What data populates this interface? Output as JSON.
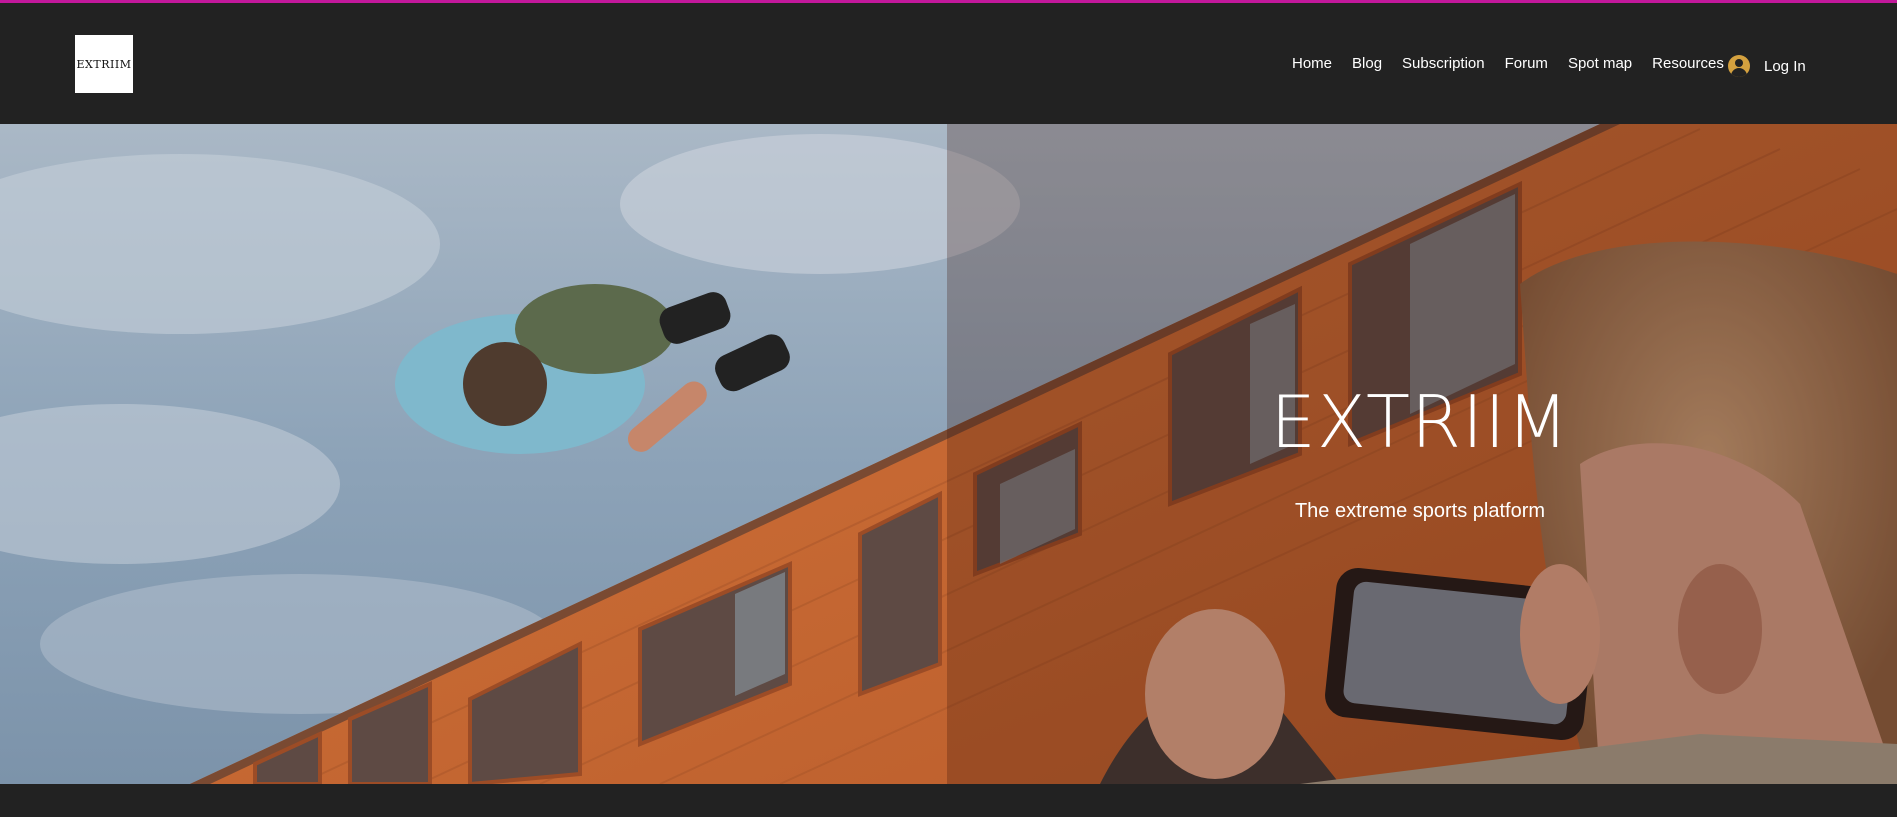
{
  "brand": {
    "logo_text": "EXTRIIM"
  },
  "nav": {
    "items": [
      {
        "label": "Home"
      },
      {
        "label": "Blog"
      },
      {
        "label": "Subscription"
      },
      {
        "label": "Forum"
      },
      {
        "label": "Spot map"
      },
      {
        "label": "Resources"
      }
    ],
    "login_label": "Log In"
  },
  "hero": {
    "title": "EXTRIIM",
    "subtitle": "The extreme sports platform"
  },
  "colors": {
    "accent": "#c2189b",
    "header_bg": "#222222",
    "avatar": "#d4a13f"
  }
}
